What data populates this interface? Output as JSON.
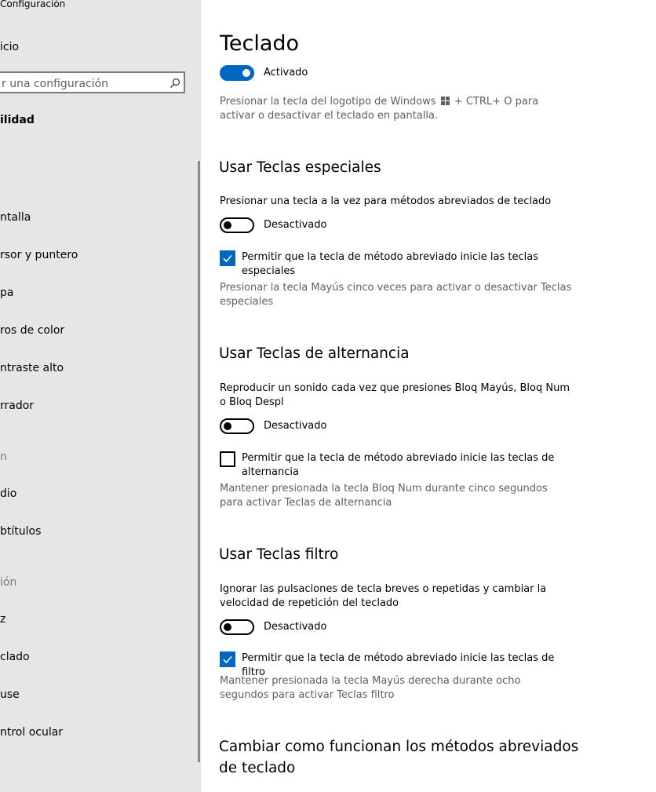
{
  "sidebar": {
    "app_title": "Configuración",
    "home_label": "icio",
    "search_placeholder": "r una configuración",
    "category": "ilidad",
    "items": [
      {
        "label": "ntalla"
      },
      {
        "label": "rsor y puntero"
      },
      {
        "label": "pa"
      },
      {
        "label": "ros de color"
      },
      {
        "label": "ntraste alto"
      },
      {
        "label": "rrador"
      },
      {
        "label": "dio"
      },
      {
        "label": "btítulos"
      },
      {
        "label": "z"
      },
      {
        "label": "clado"
      },
      {
        "label": "use"
      },
      {
        "label": "ntrol ocular"
      }
    ],
    "groups": [
      "n",
      "ión"
    ]
  },
  "main": {
    "title": "Teclado",
    "osk_toggle": {
      "state": "Activado",
      "on": true
    },
    "osk_desc_before": "Presionar la tecla del logotipo de Windows",
    "osk_desc_after": "+ CTRL+ O para activar o desactivar el teclado en pantalla.",
    "sticky": {
      "title": "Usar Teclas especiales",
      "text": "Presionar una tecla a la vez para métodos abreviados de teclado",
      "toggle_state": "Desactivado",
      "checkbox_label": "Permitir que la tecla de método abreviado inicie las teclas especiales",
      "checked": true,
      "desc": "Presionar la tecla Mayús cinco veces para activar o desactivar Teclas especiales"
    },
    "toggle_keys": {
      "title": "Usar Teclas de alternancia",
      "text": "Reproducir un sonido cada vez que presiones Bloq Mayús, Bloq Num o Bloq Despl",
      "toggle_state": "Desactivado",
      "checkbox_label": "Permitir que la tecla de método abreviado inicie las teclas de alternancia",
      "checked": false,
      "desc": "Mantener presionada la tecla Bloq Num durante cinco segundos para activar Teclas de alternancia"
    },
    "filter_keys": {
      "title": "Usar Teclas filtro",
      "text": "Ignorar las pulsaciones de tecla breves o repetidas y cambiar la velocidad de repetición del teclado",
      "toggle_state": "Desactivado",
      "checkbox_label": "Permitir que la tecla de método abreviado inicie las teclas de filtro",
      "checked": true,
      "desc": "Mantener presionada la tecla Mayús derecha durante ocho segundos para activar Teclas filtro"
    },
    "bottom_title": "Cambiar como funcionan los métodos abreviados de teclado"
  },
  "colors": {
    "accent": "#0067c0",
    "sidebar_bg": "#e6e6e6",
    "secondary_text": "#5f5f5f"
  }
}
